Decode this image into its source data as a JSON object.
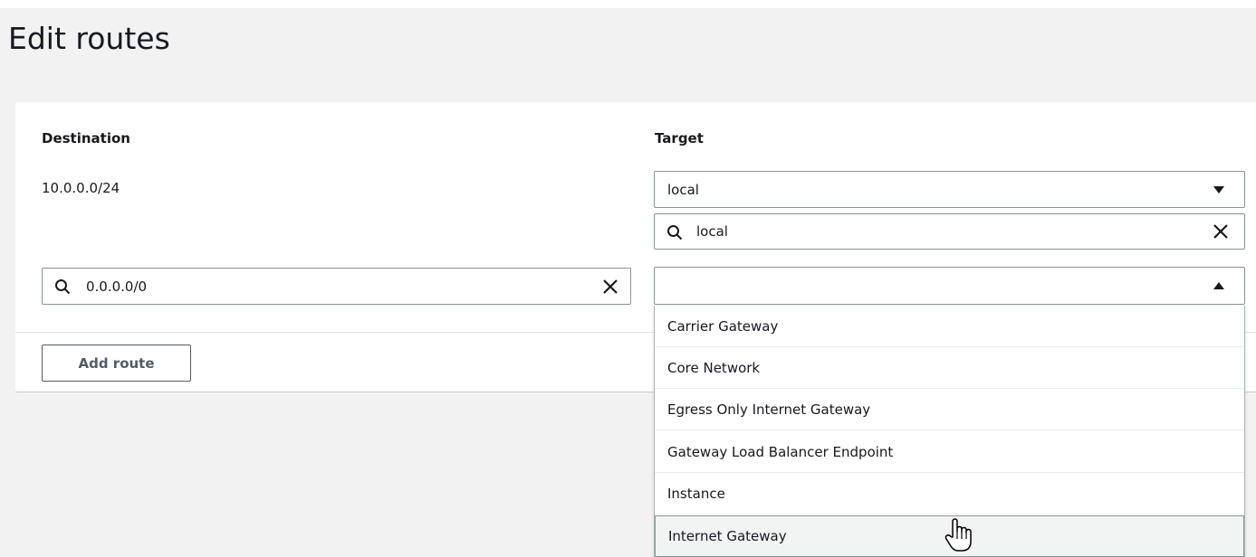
{
  "page": {
    "title": "Edit routes"
  },
  "table": {
    "destination_header": "Destination",
    "target_header": "Target"
  },
  "routes": [
    {
      "destination": "10.0.0.0/24",
      "target_value": "local",
      "target_filter": "local"
    },
    {
      "destination_search": "0.0.0.0/0",
      "target_value": ""
    }
  ],
  "target_options": [
    "Carrier Gateway",
    "Core Network",
    "Egress Only Internet Gateway",
    "Gateway Load Balancer Endpoint",
    "Instance",
    "Internet Gateway"
  ],
  "hovered_option": "Internet Gateway",
  "actions": {
    "add_route_label": "Add route"
  },
  "icons": {
    "search": "search-icon",
    "clear": "close-icon",
    "caret_down": "caret-down-icon",
    "caret_up": "caret-up-icon",
    "pointer": "hand-pointer-icon"
  }
}
